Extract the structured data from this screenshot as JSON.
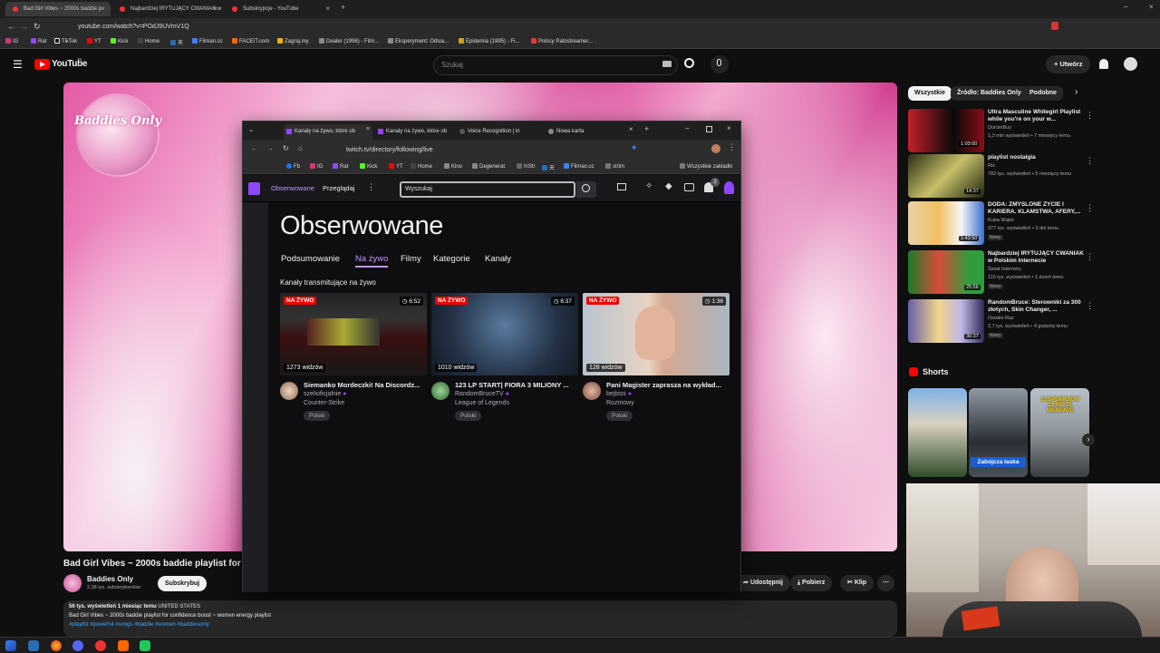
{
  "outer_browser": {
    "tabs": [
      {
        "title": "Bad Girl Vibes ~ 2000s baddie p",
        "active": true
      },
      {
        "title": "Najbardziej IRYTUJĄCY CWANIAK w",
        "active": false
      },
      {
        "title": "Subskrypcje - YouTube",
        "active": false
      }
    ],
    "url": "youtube.com/watch?v=POdJ9UVmV1Q",
    "bookmarks": [
      "IG",
      "Rat",
      "TikTok",
      "YT",
      "Kick",
      "Home",
      "天",
      "Filman.cc",
      "FACEIT.com",
      "Zagraj.my",
      "Dealer (1996) - Film...",
      "Eksperyment: Odsia...",
      "Epidemia (1995) - Fi...",
      "Polscy Patostreamer..."
    ]
  },
  "youtube": {
    "logo": "YouTube",
    "logo_suffix": "PL",
    "search_placeholder": "Szukaj",
    "create_label": "Utwórz",
    "video_title": "Bad Girl Vibes ~ 2000s baddie playlist for co",
    "channel_name": "Baddies Only",
    "subscribers": "2,38 tys. subskrybentów",
    "subscribe_label": "Subskrybuj",
    "actions": {
      "share": "Udostępnij",
      "download": "Pobierz",
      "clip": "Klip"
    },
    "description": {
      "meta": "56 tys. wyświetleń  1 miesiąc temu",
      "country": "UNITED STATES",
      "line1": "Bad Girl Vibes ~ 2000s baddie playlist for confidence boost ~ women energy playlist",
      "tags": "#playlist #powerful #songs #baddie #women #baddiesonly"
    },
    "bubble_text": "Baddies Only",
    "chips": [
      "Wszystkie",
      "Źródło: Baddies Only",
      "Podobne"
    ],
    "recommended": [
      {
        "title": "Ultra Masculine Whitegirl Playlist while you're on your w...",
        "channel": "DürümBuy",
        "meta": "1,3 mln wyświetleń • 7 miesięcy temu",
        "duration": "1:03:00",
        "badge": ""
      },
      {
        "title": "playlist nostalgia",
        "channel": "Rix",
        "meta": "782 tys. wyświetleń • 5 miesięcy temu",
        "duration": "14:37",
        "badge": ""
      },
      {
        "title": "DODA: ZMYŚLONE ŻYCIE I KARIERA. KLAMSTWA, AFERY,...",
        "channel": "Kuba Wątor",
        "meta": "377 tys. wyświetleń • 3 dni temu",
        "duration": "1:43:50",
        "badge": "Nowy"
      },
      {
        "title": "Najbardziej IRYTUJĄCY CWANIAK w Polskim Internecie",
        "channel": "Świat Internetu",
        "meta": "115 tys. wyświetleń • 1 dzień temu",
        "duration": "25:56",
        "badge": "Nowy"
      },
      {
        "title": "RandomBruce: Sterowniki za 300 złotych, Skin Changer, ...",
        "channel": "Ostatni Raz",
        "meta": "2,7 tys. wyświetleń • 4 godziny temu",
        "duration": "30:37",
        "badge": "Nowy"
      }
    ],
    "shorts_label": "Shorts",
    "shorts": [
      {
        "caption": ""
      },
      {
        "caption": "Zabójcza łaska"
      },
      {
        "caption": "210 PUNKTÓW 31 500 ZŁ MANDATU"
      }
    ]
  },
  "twitch_window": {
    "tabs": [
      "Kanały na żywo, które ob",
      "Kanały na żywo, które ob",
      "Voice Recognition | in",
      "Nowa karta"
    ],
    "url": "twitch.tv/directory/following/live",
    "bookmarks": [
      "Fb",
      "IG",
      "Rat",
      "Kick",
      "YT",
      "Home",
      "Kino",
      "Degenerat",
      "InStr",
      "天",
      "Filman.cc",
      "strim",
      "Wszystkie zakładki"
    ],
    "nav": {
      "following": "Obserwowane",
      "browse": "Przeglądaj",
      "search_placeholder": "Wyszukaj",
      "notif_count": "2"
    },
    "heading": "Obserwowane",
    "subtabs": [
      "Podsumowanie",
      "Na żywo",
      "Filmy",
      "Kategorie",
      "Kanały"
    ],
    "section_title": "Kanały transmitujące na żywo",
    "live_label": "NA ŻYWO",
    "streams": [
      {
        "title": "Siemanko Mordeczki! Na Discordz...",
        "channel": "szelioficjalnie",
        "game": "Counter-Strike",
        "viewers": "1273 widzów",
        "uptime": "6:52",
        "tag": "Polski"
      },
      {
        "title": "123 LP START| FIORA 3 MILIONY ...",
        "channel": "RandomBruceTV",
        "game": "League of Legends",
        "viewers": "1010 widzów",
        "uptime": "6:37",
        "tag": "Polski"
      },
      {
        "title": "Pani Magister zaprasza na wykład...",
        "channel": "bejbiss",
        "game": "Rozmowy",
        "viewers": "128 widzów",
        "uptime": "1:36",
        "tag": "Polski"
      }
    ]
  }
}
